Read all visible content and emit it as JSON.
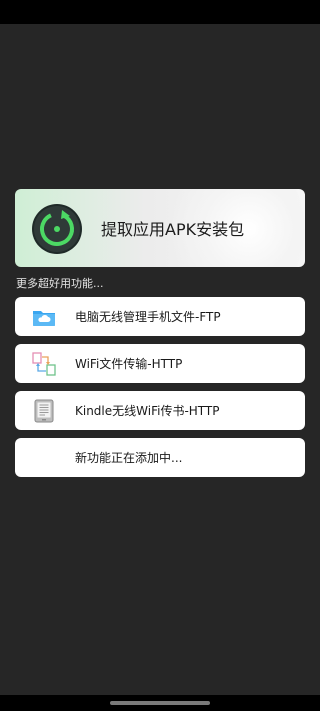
{
  "hero": {
    "title": "提取应用APK安装包",
    "icon": "apk-extract-icon"
  },
  "section": {
    "title": "更多超好用功能..."
  },
  "menu": [
    {
      "label": "电脑无线管理手机文件-FTP",
      "icon": "cloud-folder-icon"
    },
    {
      "label": "WiFi文件传输-HTTP",
      "icon": "file-transfer-icon"
    },
    {
      "label": "Kindle无线WiFi传书-HTTP",
      "icon": "kindle-book-icon"
    },
    {
      "label": "新功能正在添加中..."
    }
  ],
  "colors": {
    "background": "#262626",
    "card": "#ffffff",
    "accent_green": "#4cd964",
    "folder_blue": "#3aa6f0"
  }
}
